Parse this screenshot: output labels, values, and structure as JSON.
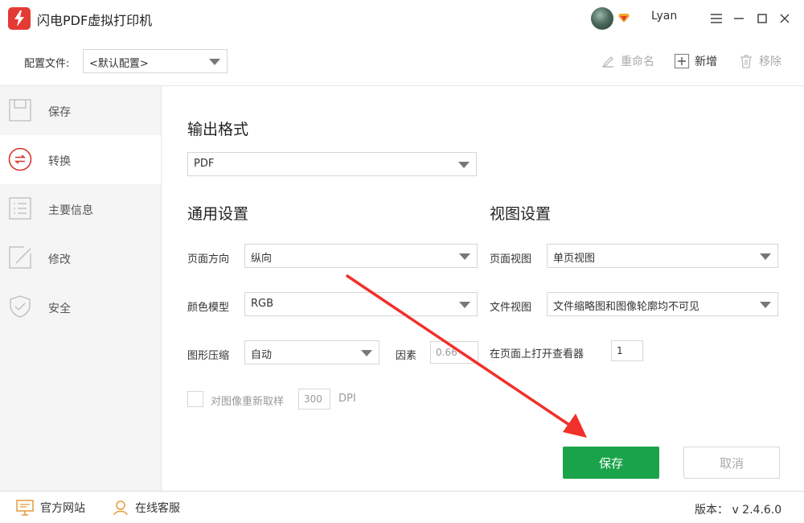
{
  "window": {
    "title": "闪电PDF虚拟打印机",
    "username": "Lyan"
  },
  "toolbar": {
    "config_label": "配置文件:",
    "config_value": "<默认配置>",
    "rename": "重命名",
    "new": "新增",
    "remove": "移除"
  },
  "sidebar": {
    "items": [
      {
        "label": "保存",
        "icon": "save-icon"
      },
      {
        "label": "转换",
        "icon": "convert-icon",
        "active": true
      },
      {
        "label": "主要信息",
        "icon": "info-list-icon"
      },
      {
        "label": "修改",
        "icon": "edit-icon"
      },
      {
        "label": "安全",
        "icon": "shield-icon"
      }
    ]
  },
  "output": {
    "title": "输出格式",
    "format": "PDF"
  },
  "general": {
    "title": "通用设置",
    "orientation_label": "页面方向",
    "orientation_value": "纵向",
    "color_label": "颜色模型",
    "color_value": "RGB",
    "compression_label": "图形压缩",
    "compression_value": "自动",
    "factor_label": "因素",
    "factor_value": "0.66",
    "resample_label": "对图像重新取样",
    "resample_value": "300",
    "resample_unit": "DPI"
  },
  "view": {
    "title": "视图设置",
    "page_view_label": "页面视图",
    "page_view_value": "单页视图",
    "doc_view_label": "文件视图",
    "doc_view_value": "文件缩略图和图像轮廓均不可见",
    "open_viewer_label": "在页面上打开查看器",
    "open_viewer_value": "1"
  },
  "actions": {
    "save": "保存",
    "cancel": "取消"
  },
  "footer": {
    "website": "官方网站",
    "support": "在线客服",
    "version": "版本： v 2.4.6.0"
  },
  "colors": {
    "accent_green": "#1aa34a",
    "logo_red": "#e43a34",
    "arrow_red": "#f0302a"
  }
}
